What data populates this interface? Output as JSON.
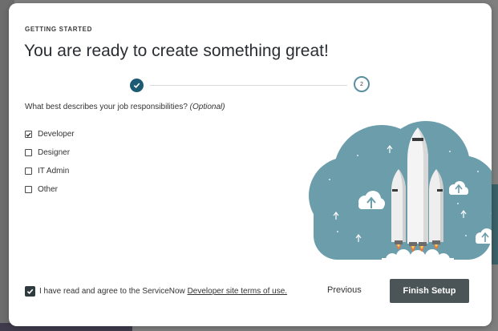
{
  "modal": {
    "eyebrow": "GETTING STARTED",
    "title": "You are ready to create something great!",
    "stepper": {
      "current_step": 2,
      "step_two_label": "2"
    },
    "question": "What best describes your job responsibilities?",
    "question_optional": "(Optional)",
    "options": [
      {
        "label": "Developer",
        "checked": true
      },
      {
        "label": "Designer",
        "checked": false
      },
      {
        "label": "IT Admin",
        "checked": false
      },
      {
        "label": "Other",
        "checked": false
      }
    ],
    "footer": {
      "terms_prefix": "I have read and agree to the ServiceNow ",
      "terms_link": "Developer site terms of use.",
      "terms_checked": true,
      "previous_label": "Previous",
      "finish_label": "Finish Setup"
    }
  },
  "colors": {
    "accent": "#1c5b73",
    "cloud": "#6b9dab",
    "button": "#4b5558"
  }
}
